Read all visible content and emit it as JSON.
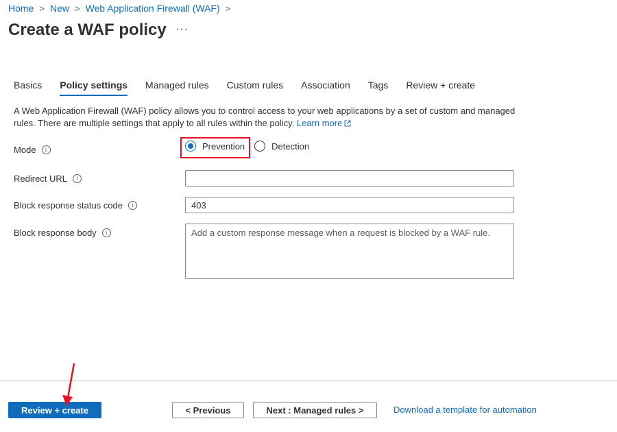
{
  "breadcrumb": {
    "items": [
      "Home",
      "New",
      "Web Application Firewall (WAF)"
    ]
  },
  "page": {
    "title": "Create a WAF policy",
    "more_label": "···"
  },
  "tabs": [
    "Basics",
    "Policy settings",
    "Managed rules",
    "Custom rules",
    "Association",
    "Tags",
    "Review + create"
  ],
  "active_tab": "Policy settings",
  "description": {
    "text": "A Web Application Firewall (WAF) policy allows you to control access to your web applications by a set of custom and managed rules. There are multiple settings that apply to all rules within the policy.",
    "learn_more": "Learn more"
  },
  "form": {
    "mode": {
      "label": "Mode",
      "options": [
        "Prevention",
        "Detection"
      ],
      "selected": "Prevention"
    },
    "redirect_url": {
      "label": "Redirect URL",
      "value": ""
    },
    "status_code": {
      "label": "Block response status code",
      "value": "403"
    },
    "response_body": {
      "label": "Block response body",
      "value": "",
      "placeholder": "Add a custom response message when a request is blocked by a WAF rule."
    }
  },
  "footer": {
    "review_create": "Review + create",
    "previous": "< Previous",
    "next": "Next : Managed rules >",
    "download": "Download a template for automation"
  },
  "icons": {
    "info": "info-icon",
    "external_link": "external-link-icon",
    "chevron": "chevron-right-icon",
    "arrow": "red-annotation-arrow"
  },
  "colors": {
    "accent": "#0f6cbd",
    "highlight": "#e81123",
    "text": "#323130"
  }
}
